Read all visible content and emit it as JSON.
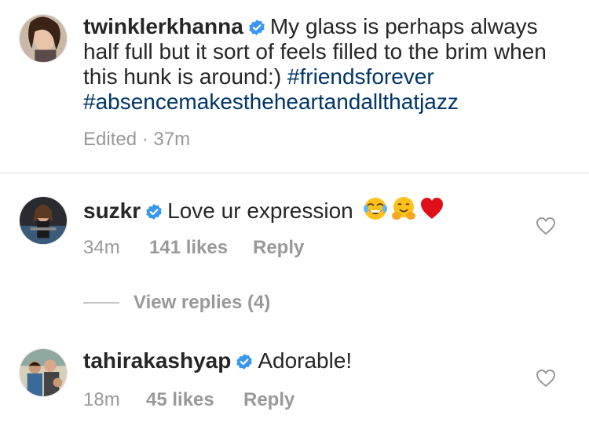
{
  "caption": {
    "username": "twinklerkhanna",
    "text": "My glass is perhaps always half full but it sort of feels filled to the brim when this hunk is around:)",
    "hashtags": [
      "#friendsforever",
      "#absencemakestheheartandallthatjazz"
    ],
    "edited": "Edited",
    "separator": "·",
    "time": "37m"
  },
  "comments": [
    {
      "username": "suzkr",
      "text": "Love ur expression",
      "emojis": [
        "face-with-tears-of-joy",
        "hugging-face",
        "red-heart"
      ],
      "time": "34m",
      "likes": "141 likes",
      "reply": "Reply",
      "view_replies": "View replies (4)"
    },
    {
      "username": "tahirakashyap",
      "text": "Adorable!",
      "time": "18m",
      "likes": "45 likes",
      "reply": "Reply"
    }
  ],
  "icons": {
    "verified": "verified-badge-icon",
    "like": "heart-outline-icon"
  },
  "colors": {
    "text": "#262626",
    "secondary": "#999999",
    "hashtag": "#003569",
    "verified": "#3897f0",
    "divider": "#dbdbdb"
  }
}
